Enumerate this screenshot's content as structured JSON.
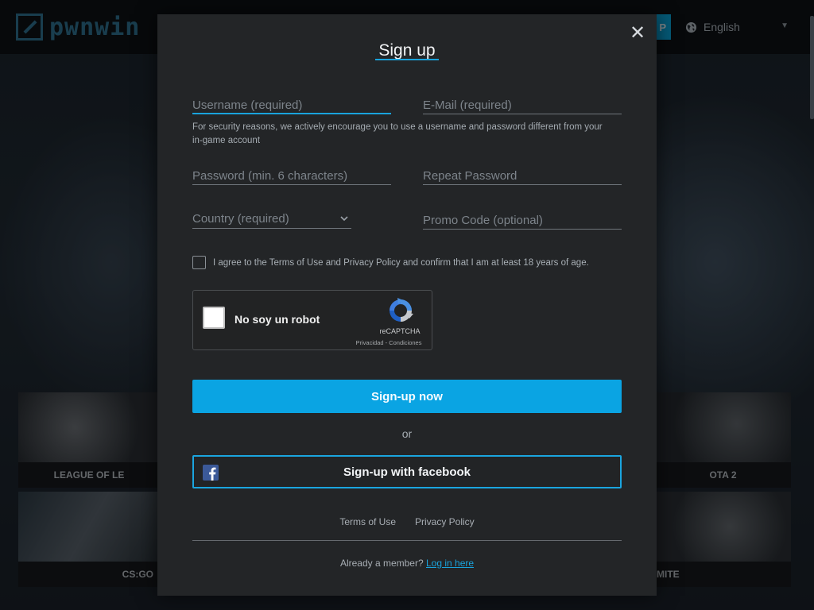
{
  "header": {
    "logo_text": "pwnwin",
    "top_button_label": "P",
    "language": "English"
  },
  "tiles": [
    {
      "label": "LEAGUE OF LE"
    },
    {
      "label": "OTA 2"
    },
    {
      "label": "CS:GO"
    },
    {
      "label": "MITE"
    }
  ],
  "modal": {
    "title": "Sign up",
    "close_symbol": "✕",
    "fields": {
      "username": {
        "placeholder": "Username (required)",
        "value": ""
      },
      "email": {
        "placeholder": "E-Mail (required)",
        "value": ""
      },
      "password": {
        "placeholder": "Password (min. 6 characters)",
        "value": ""
      },
      "repeat_password": {
        "placeholder": "Repeat Password",
        "value": ""
      },
      "country": {
        "selected": "Country (required)"
      },
      "promo": {
        "placeholder": "Promo Code (optional)",
        "value": ""
      }
    },
    "security_hint": "For security reasons, we actively encourage you to use a username and password different from your in-game account",
    "agree_text": "I agree to the Terms of Use and Privacy Policy and confirm that I am at least 18 years of age.",
    "recaptcha": {
      "label": "No soy un robot",
      "brand": "reCAPTCHA",
      "links": "Privacidad - Condiciones"
    },
    "signup_button": "Sign-up now",
    "or_text": "or",
    "facebook_button": "Sign-up with facebook",
    "footer": {
      "terms": "Terms of Use",
      "privacy": "Privacy Policy",
      "already_member": "Already a member?",
      "login_link": "Log in here"
    }
  },
  "colors": {
    "accent": "#0aa4e3",
    "modal_bg": "#232527",
    "facebook": "#3b5998"
  }
}
